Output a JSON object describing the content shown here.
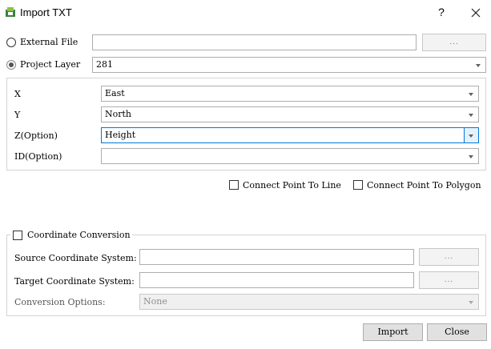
{
  "window": {
    "title": "Import TXT",
    "help": "?",
    "close_glyph": "✕"
  },
  "source": {
    "external_file_label": "External File",
    "external_file_value": "",
    "browse_label": "...",
    "project_layer_label": "Project Layer",
    "project_layer_value": "281",
    "selected": "project_layer"
  },
  "fields": {
    "x_label": "X",
    "x_value": "East",
    "y_label": "Y",
    "y_value": "North",
    "z_label": "Z(Option)",
    "z_value": "Height",
    "id_label": "ID(Option)",
    "id_value": ""
  },
  "options": {
    "connect_line_label": "Connect Point To Line",
    "connect_polygon_label": "Connect Point To Polygon"
  },
  "conversion": {
    "title": "Coordinate Conversion",
    "source_label": "Source Coordinate System:",
    "source_value": "",
    "target_label": "Target Coordinate System:",
    "target_value": "",
    "browse_label": "...",
    "options_label": "Conversion Options:",
    "options_value": "None"
  },
  "actions": {
    "import_label": "Import",
    "close_label": "Close"
  }
}
